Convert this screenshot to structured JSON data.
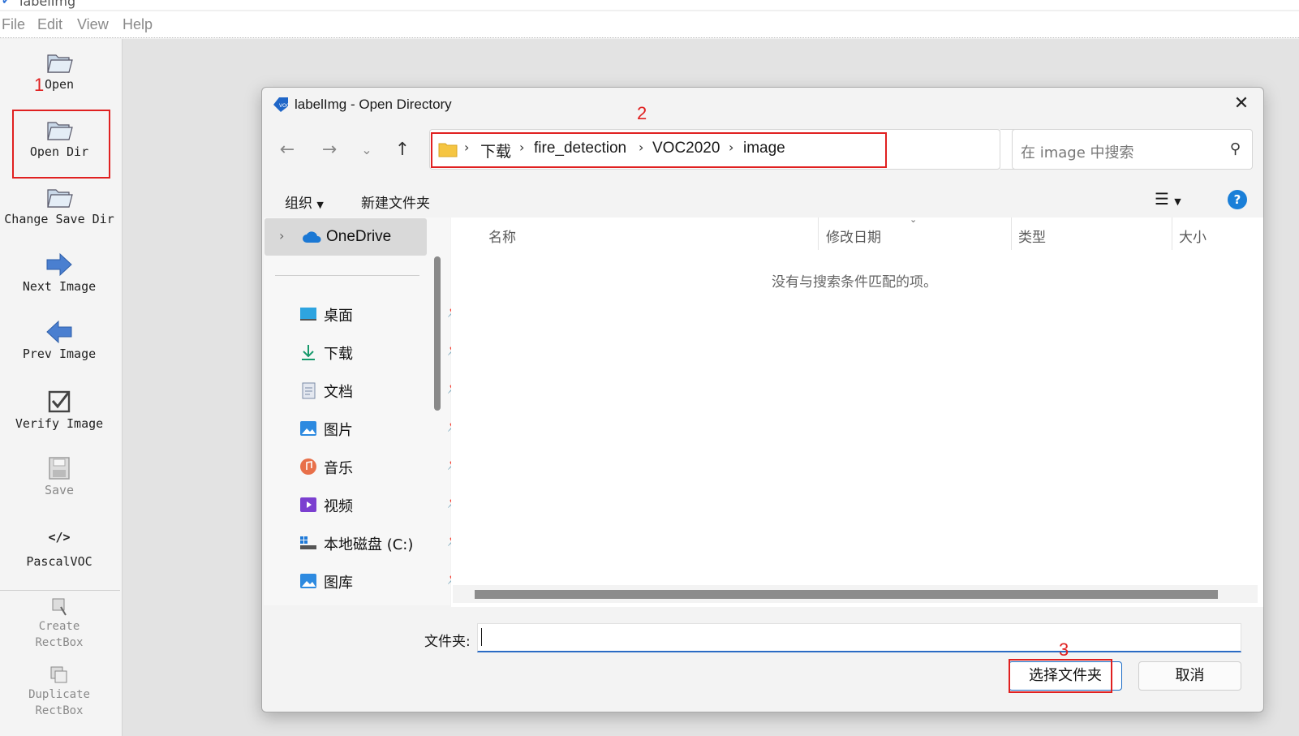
{
  "app": {
    "title": "labelImg"
  },
  "menu": {
    "items": [
      "File",
      "Edit",
      "View",
      "Help"
    ]
  },
  "toolbar": {
    "open": "Open",
    "open_dir": "Open Dir",
    "change_save_dir": "Change Save Dir",
    "next_image": "Next Image",
    "prev_image": "Prev Image",
    "verify_image": "Verify Image",
    "save": "Save",
    "format": "PascalVOC",
    "create_rectbox_1": "Create",
    "create_rectbox_2": "RectBox",
    "duplicate_rectbox_1": "Duplicate",
    "duplicate_rectbox_2": "RectBox"
  },
  "annotations": {
    "step1": "1",
    "step2": "2",
    "step3": "3"
  },
  "dialog": {
    "title": "labelImg - Open Directory",
    "breadcrumb": [
      "下载",
      "fire_detection",
      "VOC2020",
      "image"
    ],
    "search_placeholder": "在 image 中搜索",
    "organize": "组织",
    "new_folder": "新建文件夹",
    "help": "?",
    "nav": {
      "onedrive": "OneDrive",
      "items": [
        "桌面",
        "下载",
        "文档",
        "图片",
        "音乐",
        "视频",
        "本地磁盘 (C:)",
        "图库"
      ]
    },
    "columns": {
      "name": "名称",
      "modified": "修改日期",
      "type": "类型",
      "size": "大小"
    },
    "empty_message": "没有与搜索条件匹配的项。",
    "folder_label": "文件夹:",
    "folder_value": "",
    "select_button": "选择文件夹",
    "cancel_button": "取消"
  },
  "colors": {
    "accent": "#1a6cc6",
    "annotation": "#e02020",
    "arrow_blue": "#4a7fd0"
  }
}
